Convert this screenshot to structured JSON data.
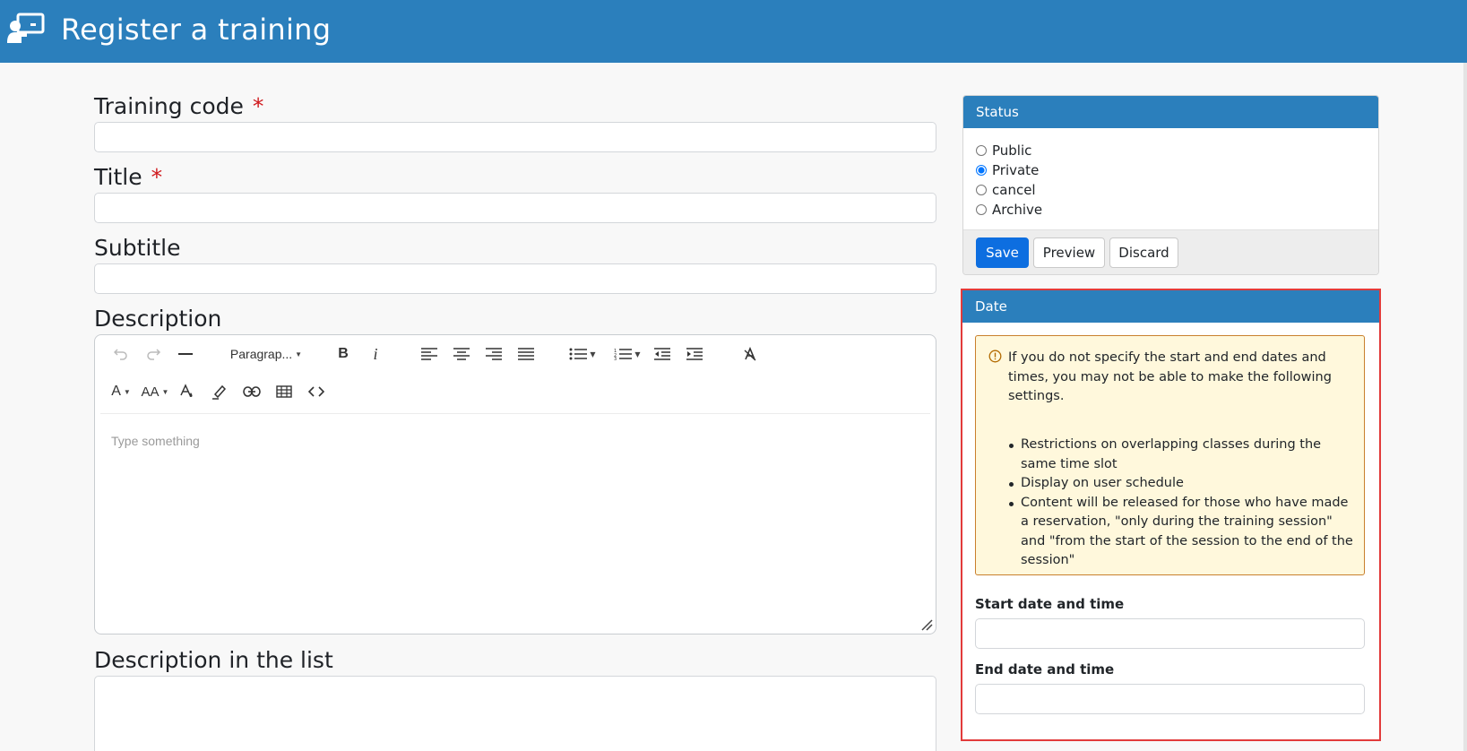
{
  "header": {
    "title": "Register a training",
    "icon": "presentation-icon"
  },
  "form": {
    "training_code_label": "Training code",
    "title_label": "Title",
    "required_mark": "*",
    "subtitle_label": "Subtitle",
    "description_label": "Description",
    "description_list_label": "Description in the list",
    "training_code_value": "",
    "title_value": "",
    "subtitle_value": "",
    "description_list_value": ""
  },
  "editor": {
    "paragraph_label": "Paragrap...",
    "placeholder": "Type something",
    "toolbar_icons": [
      "undo-icon",
      "redo-icon",
      "horizontal-rule-icon",
      "bold-icon",
      "italic-icon",
      "align-left-icon",
      "align-center-icon",
      "align-right-icon",
      "align-justify-icon",
      "bullet-list-icon",
      "numbered-list-icon",
      "outdent-icon",
      "indent-icon",
      "clear-format-icon",
      "font-family-icon",
      "font-size-icon",
      "font-color-icon",
      "highlight-icon",
      "link-icon",
      "table-icon",
      "code-icon"
    ],
    "font_label": "A",
    "size_label": "AA"
  },
  "status": {
    "title": "Status",
    "options": [
      "Public",
      "Private",
      "cancel",
      "Archive"
    ],
    "selected": "Private",
    "save": "Save",
    "preview": "Preview",
    "discard": "Discard"
  },
  "date": {
    "title": "Date",
    "notice": "If you do not specify the start and end dates and times, you may not be able to make the following settings.",
    "bullets": [
      "Restrictions on overlapping classes during the same time slot",
      "Display on user schedule",
      "Content will be released for those who have made a reservation, \"only during the training session\" and \"from the start of the session to the end of the session\""
    ],
    "start_label": "Start date and time",
    "end_label": "End date and time",
    "start_value": "",
    "end_value": ""
  },
  "colors": {
    "header_bg": "#2b7fbc",
    "primary_button": "#0d6ee0",
    "required": "#d0191d",
    "highlight_outline": "#e23b3b",
    "alert_bg": "#fff8dc"
  }
}
